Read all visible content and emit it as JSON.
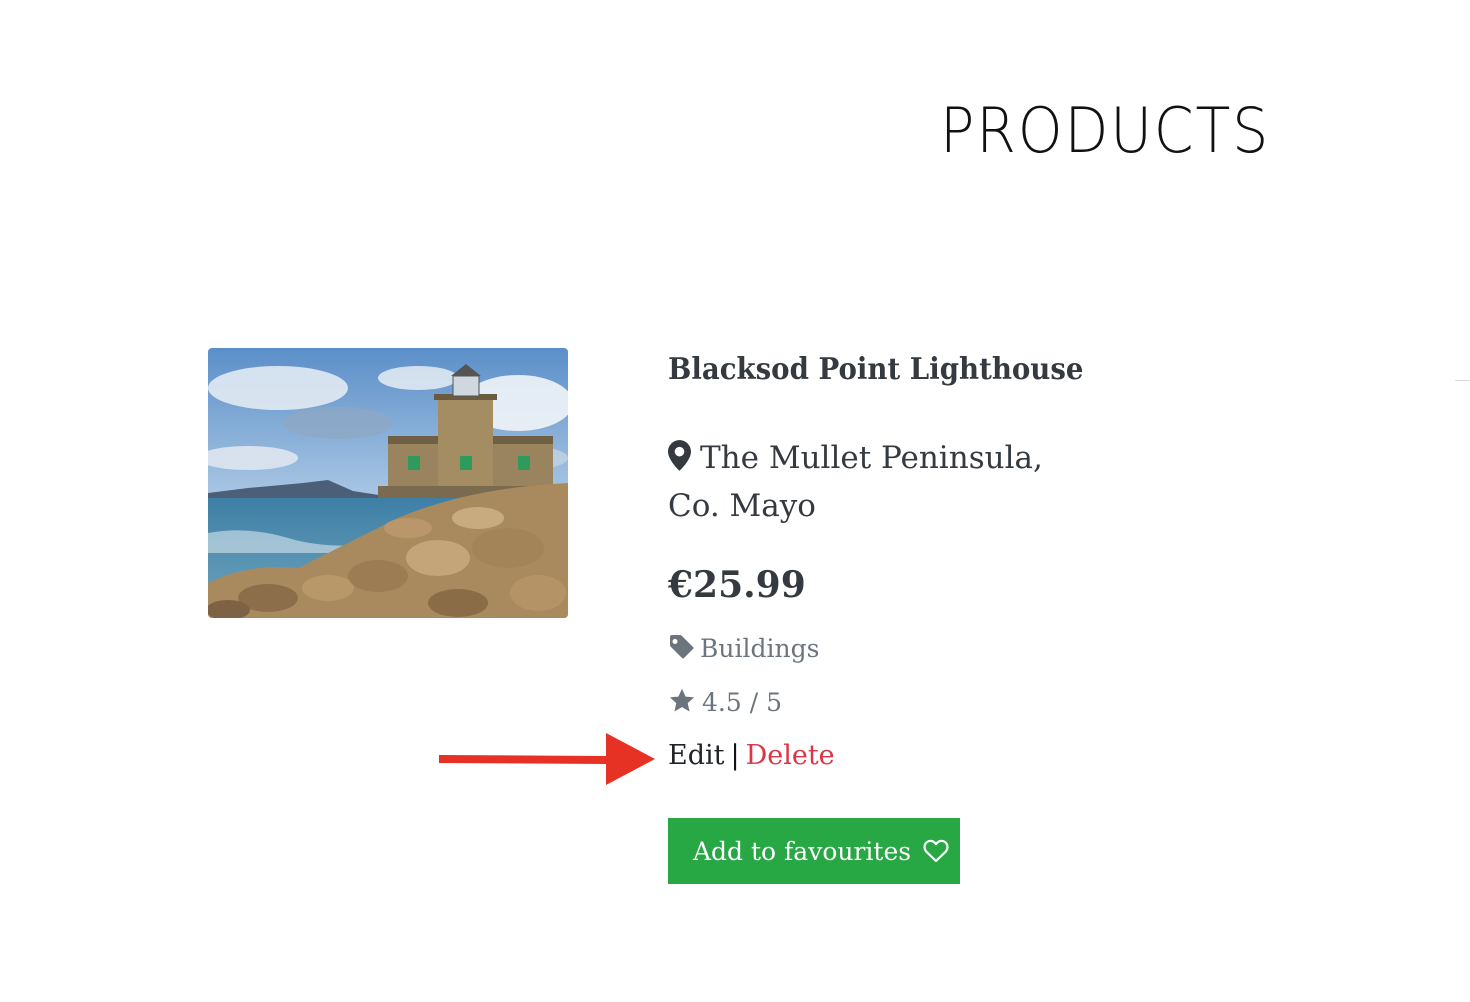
{
  "page": {
    "title": "PRODUCTS"
  },
  "product": {
    "name": "Blacksod Point Lighthouse",
    "location": "The Mullet Peninsula, Co. Mayo",
    "price": "€25.99",
    "category": "Buildings",
    "rating": "4.5 / 5",
    "image_subject": "lighthouse on rocky coastline"
  },
  "actions": {
    "edit_label": "Edit",
    "separator": "|",
    "delete_label": "Delete"
  },
  "favourite_button": {
    "label": "Add to favourites"
  },
  "icons": {
    "location": "map-marker-icon",
    "category": "tag-icon",
    "rating": "star-icon",
    "favourite": "heart-outline-icon"
  },
  "colors": {
    "button": "#28a745",
    "delete": "#dc3545",
    "muted": "#6c757d",
    "heading": "#343a40",
    "annotation_arrow": "#e53224"
  }
}
